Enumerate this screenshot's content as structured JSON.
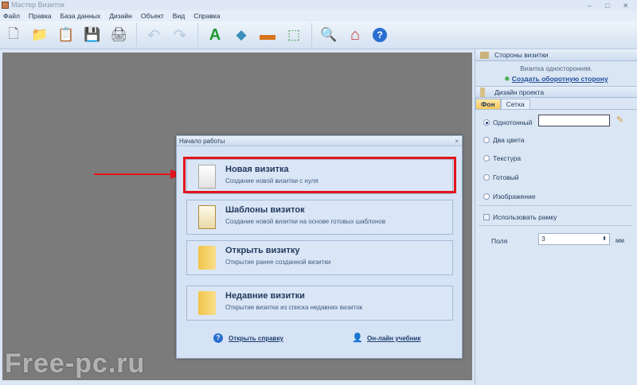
{
  "window": {
    "title": "Мастер Визиток",
    "minimize": "–",
    "maximize": "□",
    "close": "✕"
  },
  "menu": [
    "Файл",
    "Правка",
    "База данных",
    "Дизайн",
    "Объект",
    "Вид",
    "Справка"
  ],
  "toolbar": [
    {
      "name": "new-file",
      "glyph": "🗋"
    },
    {
      "name": "open-folder",
      "glyph": "📁"
    },
    {
      "name": "templates",
      "glyph": "📋"
    },
    {
      "name": "save",
      "glyph": "💾"
    },
    {
      "name": "print",
      "glyph": "🖨"
    },
    {
      "name": "undo",
      "glyph": "↶"
    },
    {
      "name": "redo",
      "glyph": "↷"
    },
    {
      "name": "text",
      "glyph": "A"
    },
    {
      "name": "shapes",
      "glyph": "◆"
    },
    {
      "name": "image",
      "glyph": "▬"
    },
    {
      "name": "select",
      "glyph": "⬚"
    },
    {
      "name": "zoom",
      "glyph": "🔍"
    },
    {
      "name": "home",
      "glyph": "⌂"
    },
    {
      "name": "help",
      "glyph": "?"
    }
  ],
  "panel": {
    "sides_header": "Стороны визитки",
    "sides_status": "Визитка односторонняя.",
    "create_back_link": "Создать оборотную сторону",
    "design_header": "Дизайн проекта",
    "tabs": [
      "Фон",
      "Сетка"
    ],
    "bg_options": [
      "Однотонный",
      "Два цвета",
      "Текстура",
      "Готовый",
      "Изображение"
    ],
    "use_frame": "Использовать рамку",
    "margins_label": "Поля",
    "margins_value": "3",
    "margins_unit": "мм"
  },
  "dialog": {
    "title": "Начало работы",
    "close": "×",
    "options": [
      {
        "title": "Новая визитка",
        "subtitle": "Создание новой визитки с нуля"
      },
      {
        "title": "Шаблоны визиток",
        "subtitle": "Создание новой визитки на основе готовых шаблонов"
      },
      {
        "title": "Открыть визитку",
        "subtitle": "Открытие ранее созданной визитки"
      },
      {
        "title": "Недавние визитки",
        "subtitle": "Открытие визитки из списка недавних визиток"
      }
    ],
    "help_link": "Открыть справку",
    "tutorial_link": "Он-лайн учебник"
  },
  "watermark": "Free-pc.ru",
  "colors": {
    "highlight": "#e3141b",
    "canvas": "#7b7b7b"
  }
}
